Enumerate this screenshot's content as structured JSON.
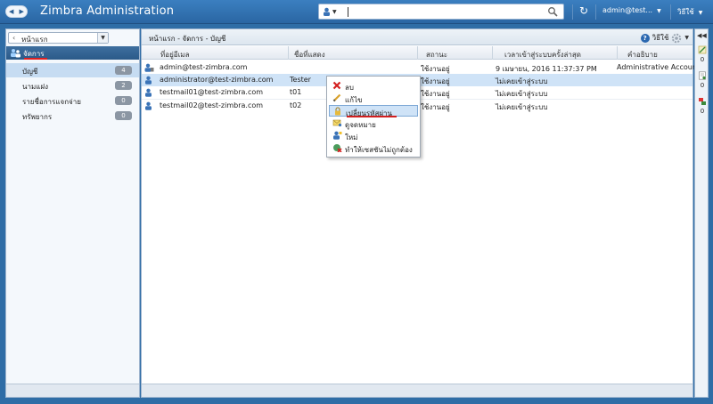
{
  "app": {
    "title": "Zimbra Administration"
  },
  "topbar": {
    "search_value": "",
    "search_placeholder": "",
    "user": "admin@test...",
    "help": "วิธีใช้"
  },
  "left": {
    "home_label": "หน้าแรก",
    "section_title": "จัดการ",
    "items": [
      {
        "label": "บัญชี",
        "count": "4"
      },
      {
        "label": "นามแฝง",
        "count": "2"
      },
      {
        "label": "รายชื่อการแจกจ่าย",
        "count": "0"
      },
      {
        "label": "ทรัพยากร",
        "count": "0"
      }
    ]
  },
  "main": {
    "breadcrumb": "หน้าแรก - จัดการ - บัญชี",
    "help": "วิธีใช้",
    "columns": [
      "ที่อยู่อีเมล",
      "ชื่อที่แสดง",
      "สถานะ",
      "เวลาเข้าสู่ระบบครั้งล่าสุด",
      "คำอธิบาย"
    ],
    "rows": [
      {
        "email": "admin@test-zimbra.com",
        "display": "",
        "status": "ใช้งานอยู่",
        "last_login": "9 เมษายน, 2016 11:37:37 PM",
        "description": "Administrative Account"
      },
      {
        "email": "administrator@test-zimbra.com",
        "display": "Tester",
        "status": "ใช้งานอยู่",
        "last_login": "ไม่เคยเข้าสู่ระบบ",
        "description": ""
      },
      {
        "email": "testmail01@test-zimbra.com",
        "display": "t01",
        "status": "ใช้งานอยู่",
        "last_login": "ไม่เคยเข้าสู่ระบบ",
        "description": ""
      },
      {
        "email": "testmail02@test-zimbra.com",
        "display": "t02",
        "status": "ใช้งานอยู่",
        "last_login": "ไม่เคยเข้าสู่ระบบ",
        "description": ""
      }
    ]
  },
  "context_menu": {
    "items": [
      "ลบ",
      "แก้ไข",
      "เปลี่ยนรหัสผ่าน",
      "ดูจดหมาย",
      "ใหม่",
      "ทำให้เซสชันไม่ถูกต้อง"
    ]
  },
  "right_rail": {
    "counts": [
      "0",
      "0",
      "0"
    ]
  },
  "colors": {
    "accent": "#2f6da6",
    "selected": "#cfe3f7",
    "highlight_line": "#d21f1f"
  }
}
